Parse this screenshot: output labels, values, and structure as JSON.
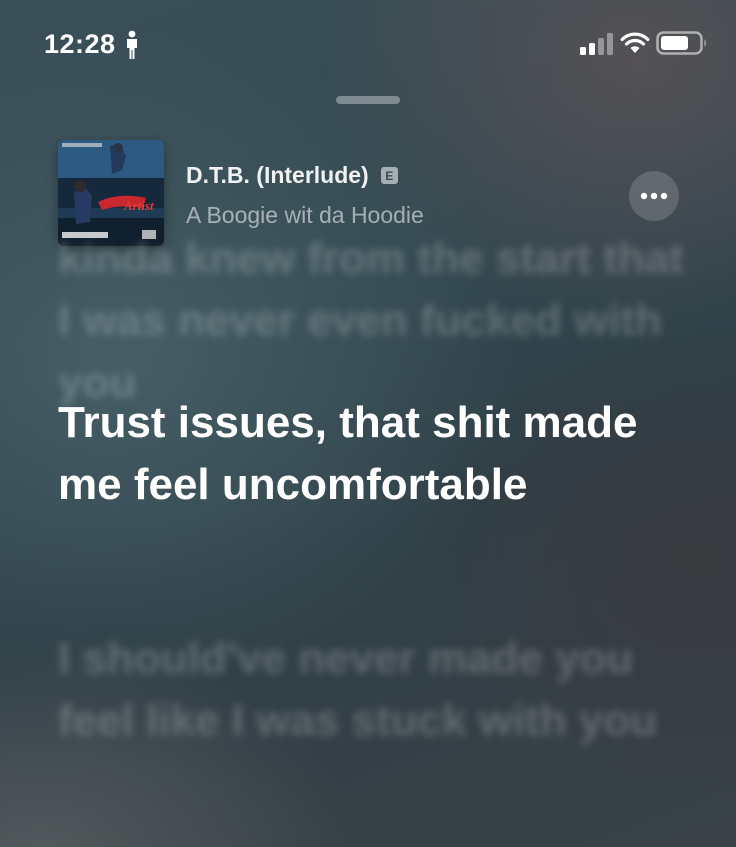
{
  "status_bar": {
    "time": "12:28",
    "icons": [
      "person-icon",
      "signal-icon",
      "wifi-icon",
      "battery-icon"
    ]
  },
  "now_playing": {
    "title": "D.T.B. (Interlude)",
    "explicit_badge": "E",
    "artist": "A Boogie wit da Hoodie",
    "artwork_icon": "album-artwork",
    "more_icon": "ellipsis-icon"
  },
  "lyrics": {
    "previous": "kinda knew from the start that I was never even fucked with you",
    "current": "Trust issues, that shit made me feel uncomfortable",
    "next": "I should've never made you feel like I was stuck with you"
  },
  "colors": {
    "background": "#334850",
    "current_lyric": "#ffffff",
    "explicit_badge": "#8a9499"
  }
}
